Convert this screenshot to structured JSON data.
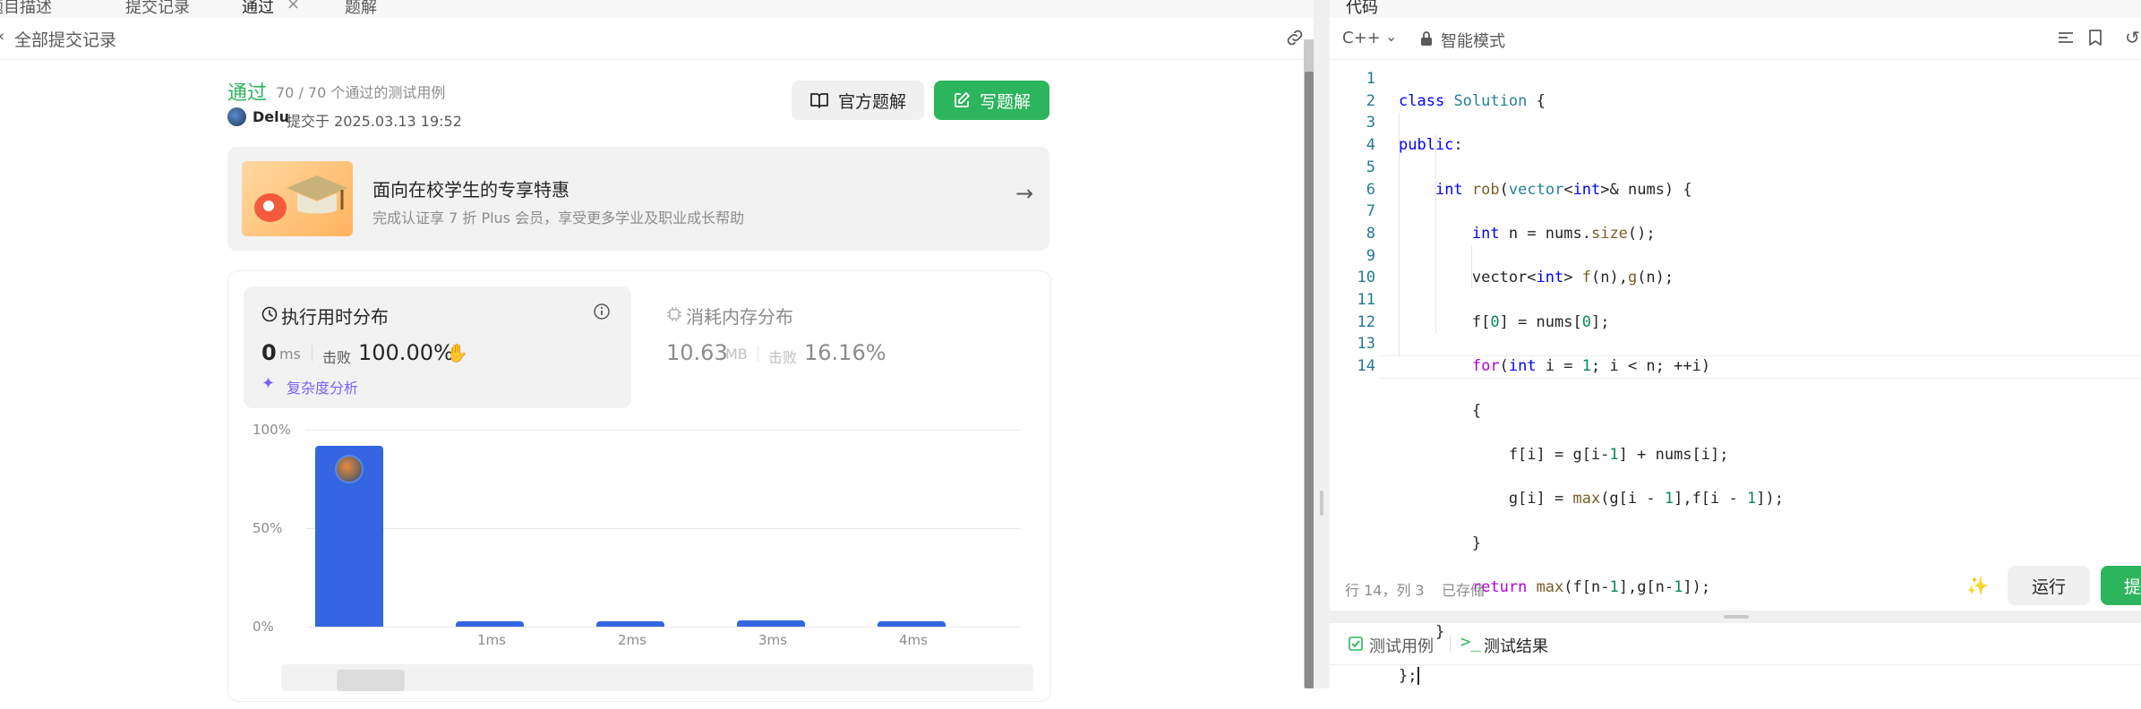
{
  "top_tabs": [
    "题目描述",
    "提交记录",
    "通过",
    "题解"
  ],
  "editor_tab": "代码",
  "back_label": "全部提交记录",
  "result": {
    "status": "通过",
    "cases": "70 / 70 个通过的测试用例",
    "user": "Delu",
    "submitted_at": "提交于 2025.03.13 19:52",
    "official_btn": "官方题解",
    "write_btn": "写题解"
  },
  "promo": {
    "title": "面向在校学生的专享特惠",
    "subtitle": "完成认证享 7 折 Plus 会员，享受更多学业及职业成长帮助"
  },
  "runtime": {
    "title": "执行用时分布",
    "value": "0",
    "unit": "ms",
    "beat_label": "击败",
    "beat_pct": "100.00%",
    "complexity_link": "复杂度分析"
  },
  "memory": {
    "title": "消耗内存分布",
    "value": "10.63",
    "unit": "MB",
    "beat_label": "击败",
    "beat_pct": "16.16%"
  },
  "chart_data": {
    "type": "bar",
    "categories": [
      "",
      "1ms",
      "2ms",
      "3ms",
      "4ms"
    ],
    "values": [
      92,
      2.5,
      2.5,
      3,
      2.5
    ],
    "ylim": [
      0,
      100
    ],
    "yticks": [
      "100%",
      "50%",
      "0%"
    ],
    "grid": true
  },
  "editor": {
    "language": "C++",
    "mode": "智能模式",
    "status_pos": "行 14，列 3",
    "saved": "已存储",
    "run_btn": "运行",
    "submit_btn": "提",
    "lines": [
      "class Solution {",
      "public:",
      "    int rob(vector<int>& nums) {",
      "        int n = nums.size();",
      "        vector<int> f(n),g(n);",
      "        f[0] = nums[0];",
      "        for(int i = 1; i < n; ++i)",
      "        {",
      "            f[i] = g[i-1] + nums[i];",
      "            g[i] = max(g[i - 1],f[i - 1]);",
      "        }",
      "        return max(f[n-1],g[n-1]);",
      "    }",
      "};"
    ]
  },
  "bottom_tabs": [
    "测试用例",
    "测试结果"
  ]
}
